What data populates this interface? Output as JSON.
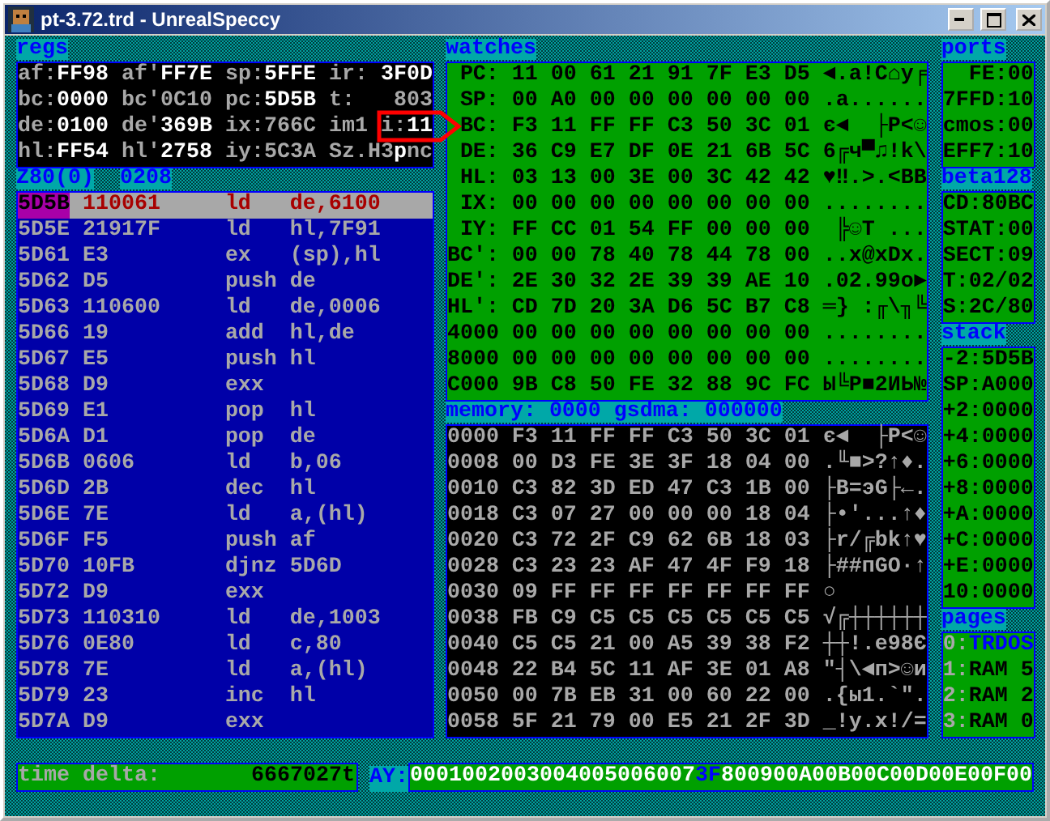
{
  "window": {
    "title": "pt-3.72.trd - UnrealSpeccy"
  },
  "regs": {
    "title": "regs",
    "rows": [
      [
        {
          "label": "af:",
          "value": "FF98",
          "changed": true
        },
        {
          "label": "af'",
          "value": "FF7E",
          "changed": true
        },
        {
          "label": "sp:",
          "value": "5FFE",
          "changed": true
        },
        {
          "label": "ir:",
          "value": "3F0D",
          "changed": true
        }
      ],
      [
        {
          "label": "bc:",
          "value": "0000",
          "changed": true
        },
        {
          "label": "bc'",
          "value": "0C10",
          "changed": false
        },
        {
          "label": "pc:",
          "value": "5D5B",
          "changed": true
        },
        {
          "label": "t:",
          "value": "803",
          "changed": false
        }
      ],
      [
        {
          "label": "de:",
          "value": "0100",
          "changed": true
        },
        {
          "label": "de'",
          "value": "369B",
          "changed": true
        },
        {
          "label": "ix:",
          "value": "766C",
          "changed": false
        },
        {
          "label": "im1"
        },
        {
          "label": "i:",
          "value": "11",
          "changed": true
        }
      ],
      [
        {
          "label": "hl:",
          "value": "FF54",
          "changed": true
        },
        {
          "label": "hl'",
          "value": "2758",
          "changed": true
        },
        {
          "label": "iy:",
          "value": "5C3A",
          "changed": false
        },
        {
          "kind": "flags",
          "parts": [
            {
              "text": "Sz.H3",
              "changed": false
            },
            {
              "text": "p",
              "changed": true
            },
            {
              "text": "nc",
              "changed": false
            }
          ]
        }
      ]
    ]
  },
  "disasm_header": [
    "Z80(0)",
    "0208"
  ],
  "disasm": {
    "rows": [
      {
        "addr": "5D5B",
        "bytes": "110061",
        "mnemonic": "ld",
        "operand": "de,6100",
        "selected": true
      },
      {
        "addr": "5D5E",
        "bytes": "21917F",
        "mnemonic": "ld",
        "operand": "hl,7F91",
        "selected": false
      },
      {
        "addr": "5D61",
        "bytes": "E3",
        "mnemonic": "ex",
        "operand": "(sp),hl",
        "selected": false
      },
      {
        "addr": "5D62",
        "bytes": "D5",
        "mnemonic": "push",
        "operand": "de",
        "selected": false
      },
      {
        "addr": "5D63",
        "bytes": "110600",
        "mnemonic": "ld",
        "operand": "de,0006",
        "selected": false
      },
      {
        "addr": "5D66",
        "bytes": "19",
        "mnemonic": "add",
        "operand": "hl,de",
        "selected": false
      },
      {
        "addr": "5D67",
        "bytes": "E5",
        "mnemonic": "push",
        "operand": "hl",
        "selected": false
      },
      {
        "addr": "5D68",
        "bytes": "D9",
        "mnemonic": "exx",
        "selected": false
      },
      {
        "addr": "5D69",
        "bytes": "E1",
        "mnemonic": "pop",
        "operand": "hl",
        "selected": false
      },
      {
        "addr": "5D6A",
        "bytes": "D1",
        "mnemonic": "pop",
        "operand": "de",
        "selected": false
      },
      {
        "addr": "5D6B",
        "bytes": "0606",
        "mnemonic": "ld",
        "operand": "b,06",
        "selected": false
      },
      {
        "addr": "5D6D",
        "bytes": "2B",
        "mnemonic": "dec",
        "operand": "hl",
        "selected": false
      },
      {
        "addr": "5D6E",
        "bytes": "7E",
        "mnemonic": "ld",
        "operand": "a,(hl)",
        "selected": false
      },
      {
        "addr": "5D6F",
        "bytes": "F5",
        "mnemonic": "push",
        "operand": "af",
        "selected": false
      },
      {
        "addr": "5D70",
        "bytes": "10FB",
        "mnemonic": "djnz",
        "operand": "5D6D",
        "selected": false
      },
      {
        "addr": "5D72",
        "bytes": "D9",
        "mnemonic": "exx",
        "selected": false
      },
      {
        "addr": "5D73",
        "bytes": "110310",
        "mnemonic": "ld",
        "operand": "de,1003",
        "selected": false
      },
      {
        "addr": "5D76",
        "bytes": "0E80",
        "mnemonic": "ld",
        "operand": "c,80",
        "selected": false
      },
      {
        "addr": "5D78",
        "bytes": "7E",
        "mnemonic": "ld",
        "operand": "a,(hl)",
        "selected": false
      },
      {
        "addr": "5D79",
        "bytes": "23",
        "mnemonic": "inc",
        "operand": "hl",
        "selected": false
      },
      {
        "addr": "5D7A",
        "bytes": "D9",
        "mnemonic": "exx",
        "selected": false
      }
    ]
  },
  "watches": {
    "title": "watches",
    "rows": [
      {
        "label": "PC:",
        "hex": "11 00 61 21 91 7F E3 D5",
        "ascii": "◄.a!С⌂у╒"
      },
      {
        "label": "SP:",
        "hex": "00 A0 00 00 00 00 00 00",
        "ascii": ".а......"
      },
      {
        "label": "BC:",
        "hex": "F3 11 FF FF C3 50 3C 01",
        "ascii": "є◄  ├P<☺"
      },
      {
        "label": "DE:",
        "hex": "36 C9 E7 DF 0E 21 6B 5C",
        "ascii": "6╔ч▀♫!k\\"
      },
      {
        "label": "HL:",
        "hex": "03 13 00 3E 00 3C 42 42",
        "ascii": "♥‼.>.<BB"
      },
      {
        "label": "IX:",
        "hex": "00 00 00 00 00 00 00 00",
        "ascii": "........"
      },
      {
        "label": "IY:",
        "hex": "FF CC 01 54 FF 00 00 00",
        "ascii": " ╠☺T ..."
      },
      {
        "label": "BC':",
        "hex": "00 00 78 40 78 44 78 00",
        "ascii": "..x@xDx."
      },
      {
        "label": "DE':",
        "hex": "2E 30 32 2E 39 39 AE 10",
        "ascii": ".02.99о►"
      },
      {
        "label": "HL':",
        "hex": "CD 7D 20 3A D6 5C B7 C8",
        "ascii": "═} :╓\\╖╚"
      },
      {
        "label": "4000",
        "hex": "00 00 00 00 00 00 00 00",
        "ascii": "........"
      },
      {
        "label": "8000",
        "hex": "00 00 00 00 00 00 00 00",
        "ascii": "........"
      },
      {
        "label": "C000",
        "hex": "9B C8 50 FE 32 88 9C FC",
        "ascii": "Ы╚P■2ИЬ№"
      }
    ]
  },
  "memory": {
    "title": "memory: 0000 gsdma: 000000",
    "rows": [
      {
        "addr": "0000",
        "hex": "F3 11 FF FF C3 50 3C 01",
        "ascii": "є◄  ├P<☺"
      },
      {
        "addr": "0008",
        "hex": "00 D3 FE 3E 3F 18 04 00",
        "ascii": ".╙■>?↑♦."
      },
      {
        "addr": "0010",
        "hex": "C3 82 3D ED 47 C3 1B 00",
        "ascii": "├В=эG├←."
      },
      {
        "addr": "0018",
        "hex": "C3 07 27 00 00 00 18 04",
        "ascii": "├•'...↑♦"
      },
      {
        "addr": "0020",
        "hex": "C3 72 2F C9 62 6B 18 03",
        "ascii": "├r/╔bk↑♥"
      },
      {
        "addr": "0028",
        "hex": "C3 23 23 AF 47 4F F9 18",
        "ascii": "├##пGO∙↑"
      },
      {
        "addr": "0030",
        "hex": "09 FF FF FF FF FF FF FF",
        "ascii": "○"
      },
      {
        "addr": "0038",
        "hex": "FB C9 C5 C5 C5 C5 C5 C5",
        "ascii": "√╔┼┼┼┼┼┼"
      },
      {
        "addr": "0040",
        "hex": "C5 C5 21 00 A5 39 38 F2",
        "ascii": "┼┼!.е98Є"
      },
      {
        "addr": "0048",
        "hex": "22 B4 5C 11 AF 3E 01 A8",
        "ascii": "\"┤\\◄п>☺и"
      },
      {
        "addr": "0050",
        "hex": "00 7B EB 31 00 60 22 00",
        "ascii": ".{ы1.`\"."
      },
      {
        "addr": "0058",
        "hex": "5F 21 79 00 E5 21 2F 3D",
        "ascii": "_!y.х!/="
      }
    ]
  },
  "ports": {
    "title": "ports",
    "rows": [
      "FE:00",
      "7FFD:10",
      "cmos:00",
      "EFF7:10"
    ]
  },
  "beta128": {
    "title": "beta128",
    "rows": [
      "CD:80BC",
      "STAT:00",
      "SECT:09",
      "T:02/02",
      "S:2C/80"
    ]
  },
  "stack": {
    "title": "stack",
    "rows": [
      "-2:5D5B",
      "SP:A000",
      "+2:0000",
      "+4:0000",
      "+6:0000",
      "+8:0000",
      "+A:0000",
      "+C:0000",
      "+E:0000",
      "10:0000"
    ]
  },
  "pages": {
    "title": "pages",
    "rows": [
      {
        "index": "0:",
        "name": "TRDOS",
        "selected": true
      },
      {
        "index": "1:",
        "name": "RAM 5",
        "selected": false
      },
      {
        "index": "2:",
        "name": "RAM 2",
        "selected": false
      },
      {
        "index": "3:",
        "name": "RAM 0",
        "selected": false
      }
    ]
  },
  "time_delta": {
    "label": "time delta:",
    "value": "6667027t"
  },
  "ay": {
    "label": "AY:",
    "registers": [
      {
        "index": "0",
        "value": "00",
        "changed": false
      },
      {
        "index": "1",
        "value": "00",
        "changed": false
      },
      {
        "index": "2",
        "value": "00",
        "changed": false
      },
      {
        "index": "3",
        "value": "00",
        "changed": false
      },
      {
        "index": "4",
        "value": "00",
        "changed": false
      },
      {
        "index": "5",
        "value": "00",
        "changed": false
      },
      {
        "index": "6",
        "value": "00",
        "changed": false
      },
      {
        "index": "7",
        "value": "3F",
        "changed": true
      },
      {
        "index": "8",
        "value": "00",
        "changed": false
      },
      {
        "index": "9",
        "value": "00",
        "changed": false
      },
      {
        "index": "A",
        "value": "00",
        "changed": false
      },
      {
        "index": "B",
        "value": "00",
        "changed": false
      },
      {
        "index": "C",
        "value": "00",
        "changed": false
      },
      {
        "index": "D",
        "value": "00",
        "changed": false
      },
      {
        "index": "E",
        "value": "00",
        "changed": false
      },
      {
        "index": "F",
        "value": "00",
        "changed": false
      }
    ]
  }
}
